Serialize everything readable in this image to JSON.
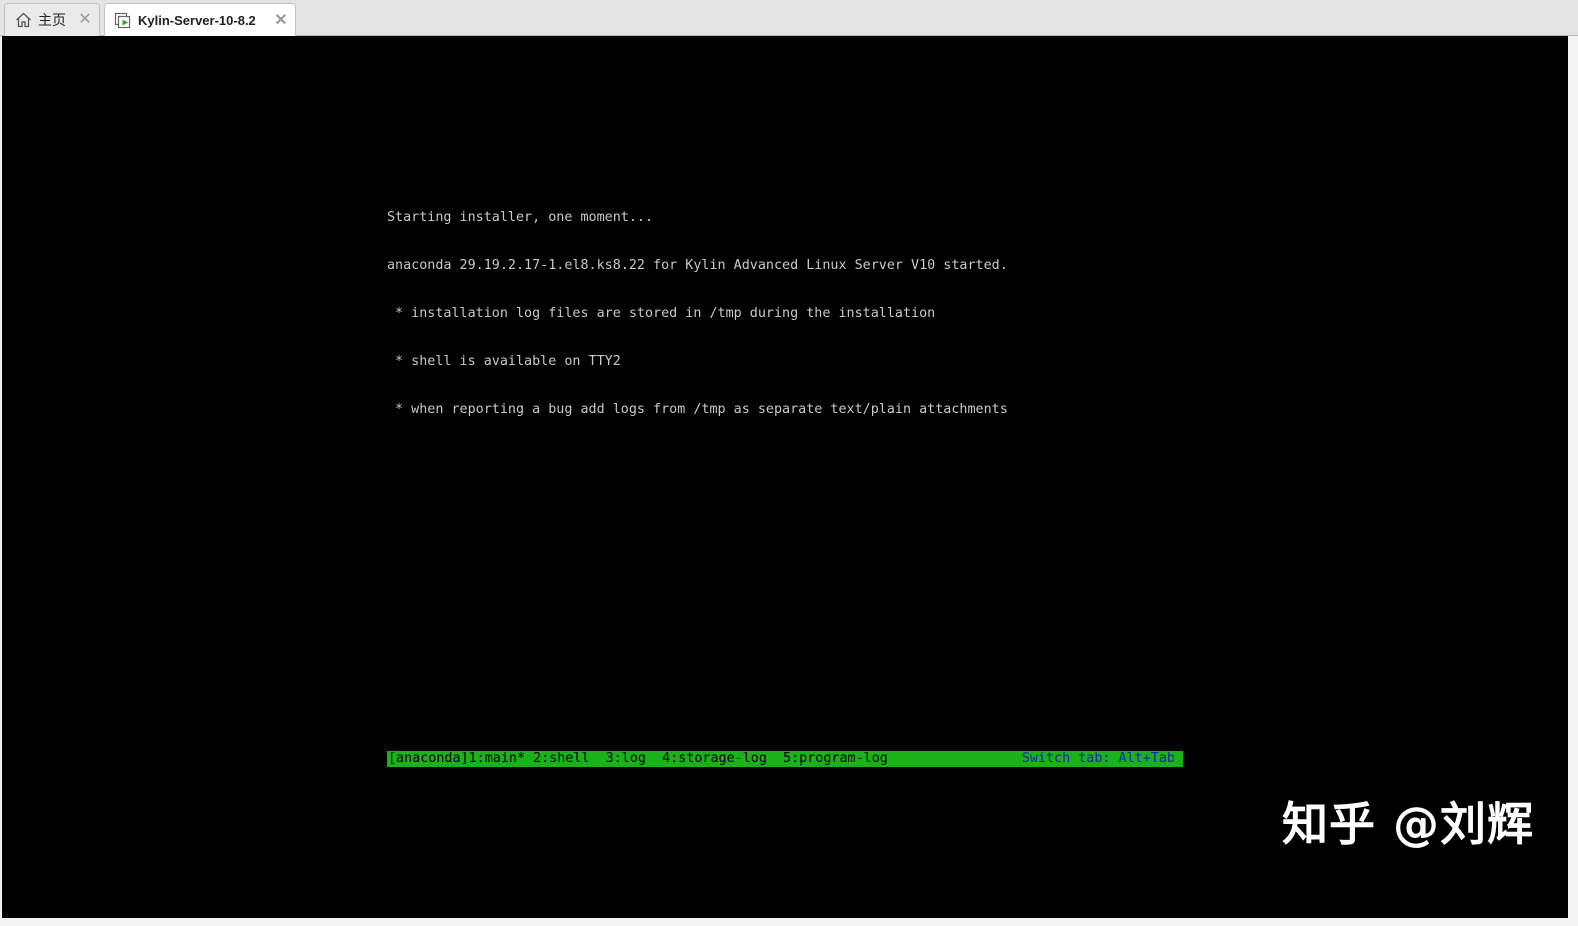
{
  "tabs": [
    {
      "label": "主页",
      "icon": "home-icon",
      "active": false
    },
    {
      "label": "Kylin-Server-10-8.2",
      "icon": "vm-running-icon",
      "active": true
    }
  ],
  "console": {
    "lines": [
      "Starting installer, one moment...",
      "anaconda 29.19.2.17-1.el8.ks8.22 for Kylin Advanced Linux Server V10 started.",
      " * installation log files are stored in /tmp during the installation",
      " * shell is available on TTY2",
      " * when reporting a bug add logs from /tmp as separate text/plain attachments"
    ],
    "status_tabs": "[anaconda]1:main* 2:shell  3:log  4:storage-log  5:program-log",
    "status_hint": "Switch tab: Alt+Tab"
  },
  "watermark": "知乎 @刘辉",
  "colors": {
    "console_bg": "#000000",
    "console_text": "#c8c8c8",
    "status_bar_bg": "#1ab11a",
    "status_hint_text": "#1a22b4",
    "vm_icon_accent": "#2eaa2e"
  }
}
